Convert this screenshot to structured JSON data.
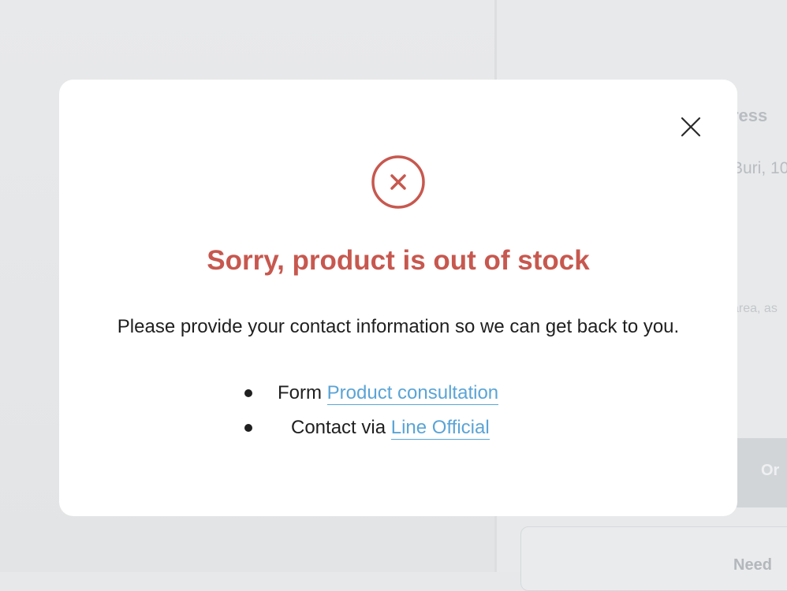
{
  "background": {
    "heading_partial": "ress",
    "address_partial": "Buri, 10",
    "hint_partial": "area, as",
    "order_button_partial": "Or",
    "help_partial": "Need"
  },
  "modal": {
    "close_icon": "close-icon",
    "status_icon": "error-circle-x-icon",
    "title": "Sorry, product is out of stock",
    "message": "Please provide your contact information so we can get back to you.",
    "options": [
      {
        "prefix": "Form",
        "link": "Product consultation"
      },
      {
        "prefix": "Contact via",
        "link": "Line Official"
      }
    ]
  },
  "colors": {
    "title": "#c7584f",
    "link": "#5aa4d6",
    "text": "#1f1f1f",
    "overlay": "#e6e8ea"
  }
}
